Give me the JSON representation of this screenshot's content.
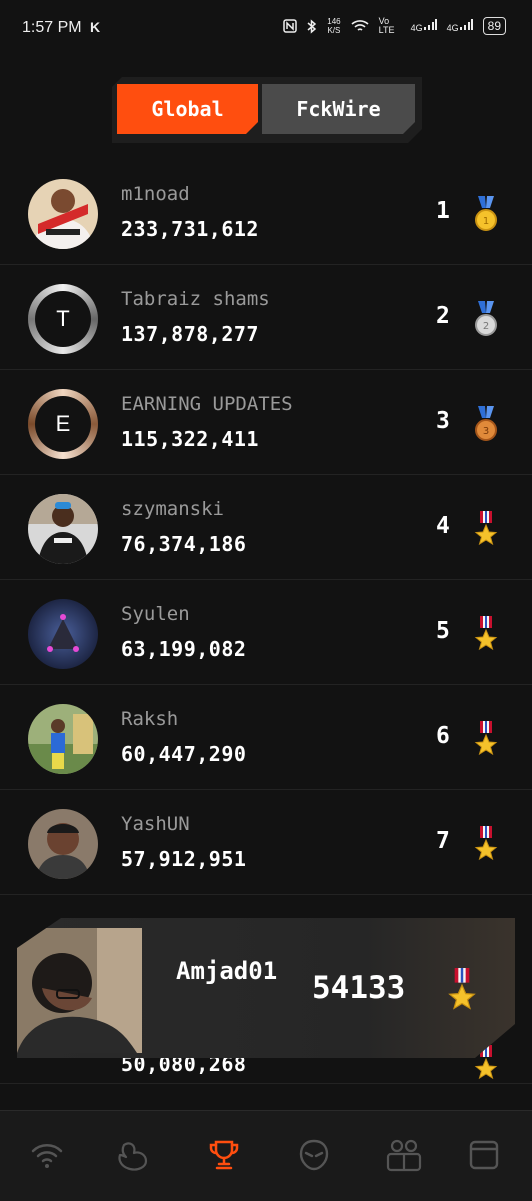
{
  "status_bar": {
    "time": "1:57 PM",
    "app_indicator": "K",
    "speed": "146",
    "speed_unit": "K/S",
    "network_1": "Vo LTE",
    "network_2": "4G",
    "network_3": "4G",
    "battery": "89"
  },
  "tabs": [
    {
      "label": "Global",
      "active": true
    },
    {
      "label": "FckWire",
      "active": false
    }
  ],
  "leaderboard": [
    {
      "name": "m1noad",
      "score": "233,731,612",
      "rank": "1",
      "medal": "gold-medal-icon",
      "avatar": "photo"
    },
    {
      "name": "Tabraiz shams",
      "score": "137,878,277",
      "rank": "2",
      "medal": "silver-medal-icon",
      "avatar_letter": "T"
    },
    {
      "name": "EARNING UPDATES",
      "score": "115,322,411",
      "rank": "3",
      "medal": "bronze-medal-icon",
      "avatar_letter": "E"
    },
    {
      "name": "szymanski",
      "score": "76,374,186",
      "rank": "4",
      "medal": "star-medal-icon",
      "avatar": "photo"
    },
    {
      "name": "Syulen",
      "score": "63,199,082",
      "rank": "5",
      "medal": "star-medal-icon",
      "avatar": "photo"
    },
    {
      "name": "Raksh",
      "score": "60,447,290",
      "rank": "6",
      "medal": "star-medal-icon",
      "avatar": "photo"
    },
    {
      "name": "YashUN",
      "score": "57,912,951",
      "rank": "7",
      "medal": "star-medal-icon",
      "avatar": "photo"
    },
    {
      "name": "",
      "score": "50,080,268",
      "rank": "",
      "medal": "star-medal-icon",
      "avatar": "photo"
    }
  ],
  "my_card": {
    "name": "Amjad01",
    "score": "54133",
    "medal": "star-medal-icon"
  },
  "nav": [
    "wifi-icon",
    "bird-icon",
    "trophy-icon",
    "alien-icon",
    "friends-icon",
    "window-icon"
  ],
  "colors": {
    "accent": "#ff4e0f",
    "background": "#121212",
    "tab_inactive": "#4b4b4b"
  }
}
